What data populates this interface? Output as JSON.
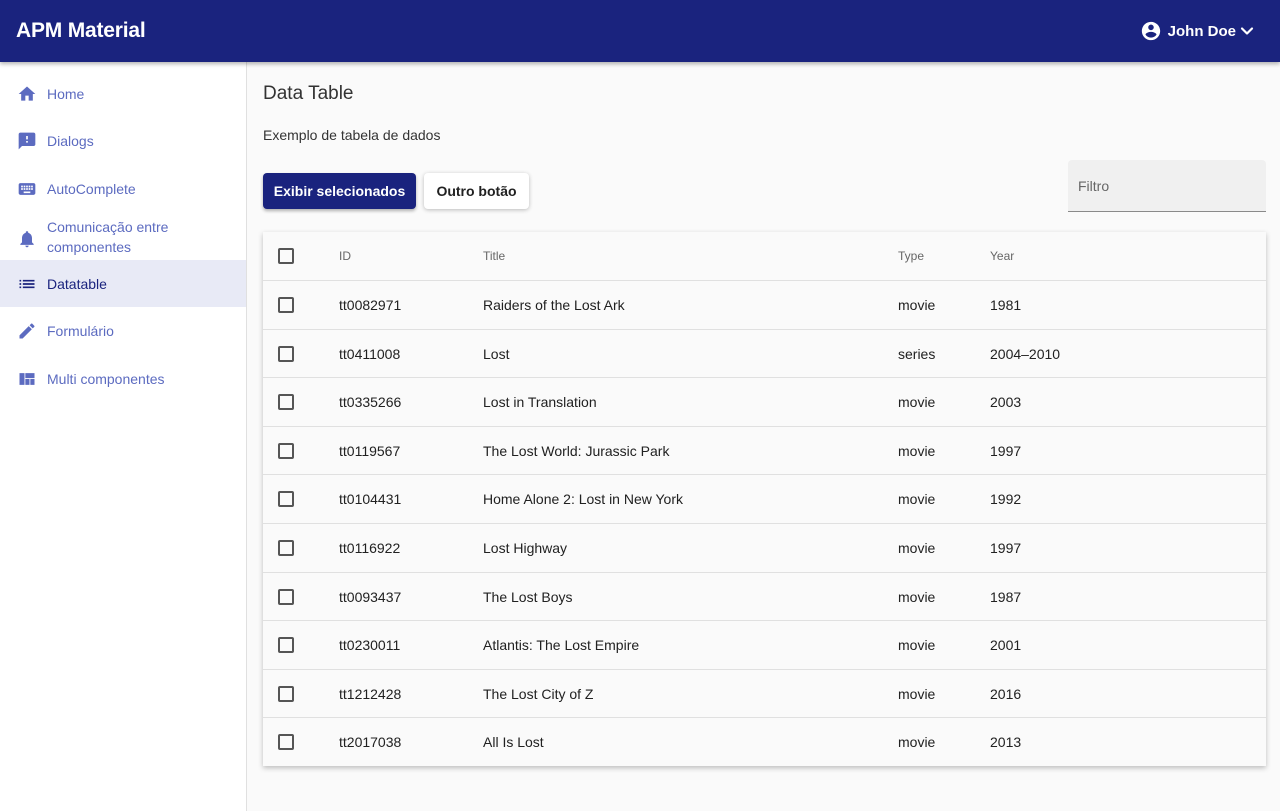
{
  "app": {
    "title": "APM Material"
  },
  "user": {
    "name": "John Doe",
    "avatar_icon": "account-circle-icon",
    "menu_icon": "chevron-down-icon"
  },
  "sidebar": {
    "items": [
      {
        "label": "Home",
        "icon": "home-icon",
        "active": false
      },
      {
        "label": "Dialogs",
        "icon": "feedback-icon",
        "active": false
      },
      {
        "label": "AutoComplete",
        "icon": "keyboard-icon",
        "active": false
      },
      {
        "label": "Comunicação entre componentes",
        "icon": "bell-icon",
        "active": false
      },
      {
        "label": "Datatable",
        "icon": "list-icon",
        "active": true
      },
      {
        "label": "Formulário",
        "icon": "pencil-icon",
        "active": false
      },
      {
        "label": "Multi componentes",
        "icon": "dashboard-icon",
        "active": false
      }
    ]
  },
  "page": {
    "title": "Data Table",
    "subtitle": "Exemplo de tabela de dados"
  },
  "actions": {
    "primary_label": "Exibir selecionados",
    "secondary_label": "Outro botão"
  },
  "filter": {
    "placeholder": "Filtro",
    "value": ""
  },
  "table": {
    "headers": {
      "id": "ID",
      "title": "Title",
      "type": "Type",
      "year": "Year"
    },
    "rows": [
      {
        "id": "tt0082971",
        "title": "Raiders of the Lost Ark",
        "type": "movie",
        "year": "1981",
        "checked": false
      },
      {
        "id": "tt0411008",
        "title": "Lost",
        "type": "series",
        "year": "2004–2010",
        "checked": false
      },
      {
        "id": "tt0335266",
        "title": "Lost in Translation",
        "type": "movie",
        "year": "2003",
        "checked": false
      },
      {
        "id": "tt0119567",
        "title": "The Lost World: Jurassic Park",
        "type": "movie",
        "year": "1997",
        "checked": false
      },
      {
        "id": "tt0104431",
        "title": "Home Alone 2: Lost in New York",
        "type": "movie",
        "year": "1992",
        "checked": false
      },
      {
        "id": "tt0116922",
        "title": "Lost Highway",
        "type": "movie",
        "year": "1997",
        "checked": false
      },
      {
        "id": "tt0093437",
        "title": "The Lost Boys",
        "type": "movie",
        "year": "1987",
        "checked": false
      },
      {
        "id": "tt0230011",
        "title": "Atlantis: The Lost Empire",
        "type": "movie",
        "year": "2001",
        "checked": false
      },
      {
        "id": "tt1212428",
        "title": "The Lost City of Z",
        "type": "movie",
        "year": "2016",
        "checked": false
      },
      {
        "id": "tt2017038",
        "title": "All Is Lost",
        "type": "movie",
        "year": "2013",
        "checked": false
      }
    ]
  },
  "colors": {
    "primary": "#1a237e",
    "nav_text": "#5c6bc0",
    "nav_active_bg": "#e8eaf6"
  }
}
